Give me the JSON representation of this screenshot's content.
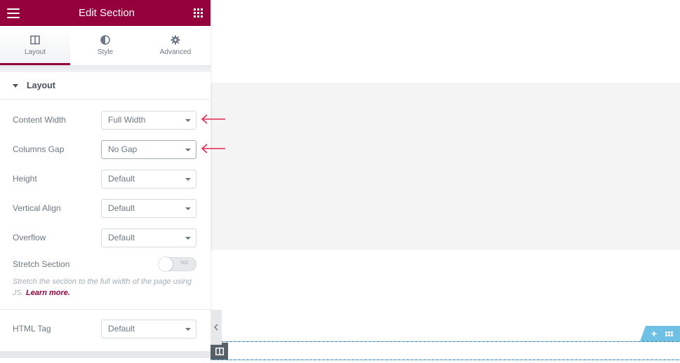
{
  "header": {
    "title": "Edit Section",
    "menu_icon": "hamburger-icon",
    "apps_icon": "grid-icon"
  },
  "tabs": [
    {
      "label": "Layout",
      "icon": "columns-icon",
      "active": true
    },
    {
      "label": "Style",
      "icon": "half-circle-icon",
      "active": false
    },
    {
      "label": "Advanced",
      "icon": "gear-icon",
      "active": false
    }
  ],
  "section": {
    "title": "Layout",
    "controls": [
      {
        "label": "Content Width",
        "value": "Full Width"
      },
      {
        "label": "Columns Gap",
        "value": "No Gap"
      },
      {
        "label": "Height",
        "value": "Default"
      },
      {
        "label": "Vertical Align",
        "value": "Default"
      },
      {
        "label": "Overflow",
        "value": "Default"
      }
    ],
    "stretch": {
      "label": "Stretch Section",
      "toggle_text": "NO",
      "checked": false,
      "description": "Stretch the section to the full width of the page using JS.",
      "link_text": "Learn more."
    },
    "html_tag": {
      "label": "HTML Tag",
      "value": "Default"
    }
  },
  "colors": {
    "brand": "#93003c",
    "annotation_arrow": "#e0254f",
    "section_handle": "#6ec1e4",
    "edit_handle": "#556068",
    "preview_band": "#f5f4f4"
  }
}
